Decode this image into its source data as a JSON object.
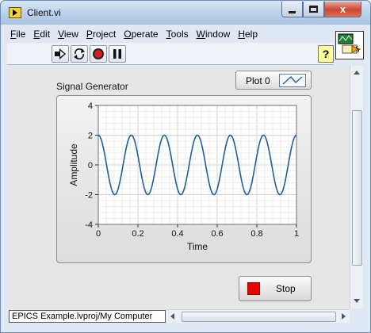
{
  "window": {
    "title": "Client.vi",
    "close_glyph": "x"
  },
  "menu": {
    "items": [
      {
        "accel": "F",
        "rest": "ile"
      },
      {
        "accel": "E",
        "rest": "dit"
      },
      {
        "accel": "V",
        "rest": "iew"
      },
      {
        "accel": "P",
        "rest": "roject"
      },
      {
        "accel": "O",
        "rest": "perate"
      },
      {
        "accel": "T",
        "rest": "ools"
      },
      {
        "accel": "W",
        "rest": "indow"
      },
      {
        "accel": "H",
        "rest": "elp"
      }
    ]
  },
  "toolbar": {
    "help_label": "?",
    "icons": [
      "run-arrow-icon",
      "run-continuously-icon",
      "abort-icon",
      "pause-icon"
    ]
  },
  "graph": {
    "label": "Signal Generator",
    "legend_label": "Plot 0",
    "x_title": "Time",
    "y_title": "Amplitude",
    "line_color": "#1f5f9f"
  },
  "stop_button": {
    "label": "Stop",
    "color": "#e60000"
  },
  "status": {
    "project_path": "EPICS Example.lvproj/My Computer"
  },
  "chart_data": {
    "type": "line",
    "title": "Signal Generator",
    "xlabel": "Time",
    "ylabel": "Amplitude",
    "xlim": [
      0,
      1
    ],
    "ylim": [
      -4,
      4
    ],
    "x_ticks": [
      "0",
      "0.2",
      "0.4",
      "0.6",
      "0.8",
      "1"
    ],
    "y_ticks": [
      "4",
      "2",
      "0",
      "-2",
      "-4"
    ],
    "grid": true,
    "series": [
      {
        "name": "Plot 0",
        "signal": "sine",
        "amplitude": 2,
        "cycles": 6,
        "phase_deg": 90
      }
    ]
  }
}
